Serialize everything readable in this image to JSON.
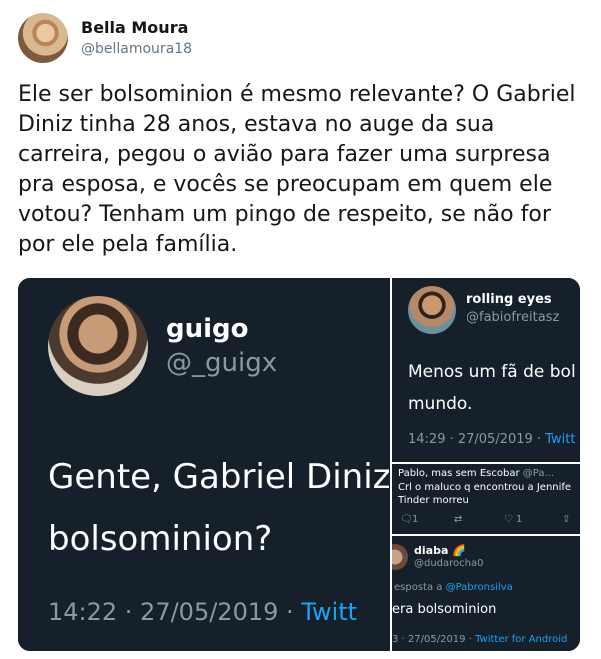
{
  "author": {
    "name": "Bella Moura",
    "handle": "@bellamoura18"
  },
  "tweet": {
    "text": "Ele ser bolsominion é mesmo relevante? O Gabriel Diniz tinha 28 anos, estava no auge da sua carreira, pegou o avião para fazer uma surpresa pra esposa, e vocês se preocupam em quem ele votou? Tenham um pingo de respeito, se não for por ele pela família."
  },
  "media": {
    "left": {
      "name": "guigo",
      "handle": "@_guigx",
      "line1": "Gente, Gabriel Diniz",
      "line2": "bolsominion?",
      "time": "14:22 · 27/05/2019 · ",
      "source": "Twitt"
    },
    "right_top": {
      "name": "rolling eyes",
      "handle": "@fabiofreitasz",
      "line1": "Menos um fã de bol",
      "line2": "mundo.",
      "time": "14:29 · 27/05/2019 · ",
      "source": "Twitt"
    },
    "right_mid": {
      "name": "Pablo, mas sem Escobar",
      "handle": "@Pa...",
      "line1": "Crl o maluco q encontrou a Jennife",
      "line2": "Tinder morreu",
      "reply_count": "1",
      "like_count": "1"
    },
    "right_bot": {
      "name": "diaba 🌈",
      "handle": "@dudarocha0",
      "reply_prefix": "esposta a ",
      "reply_link": "@Pabronsilva",
      "text": "era bolsominion",
      "time": "3 · 27/05/2019 · ",
      "source": "Twitter for Android"
    }
  }
}
